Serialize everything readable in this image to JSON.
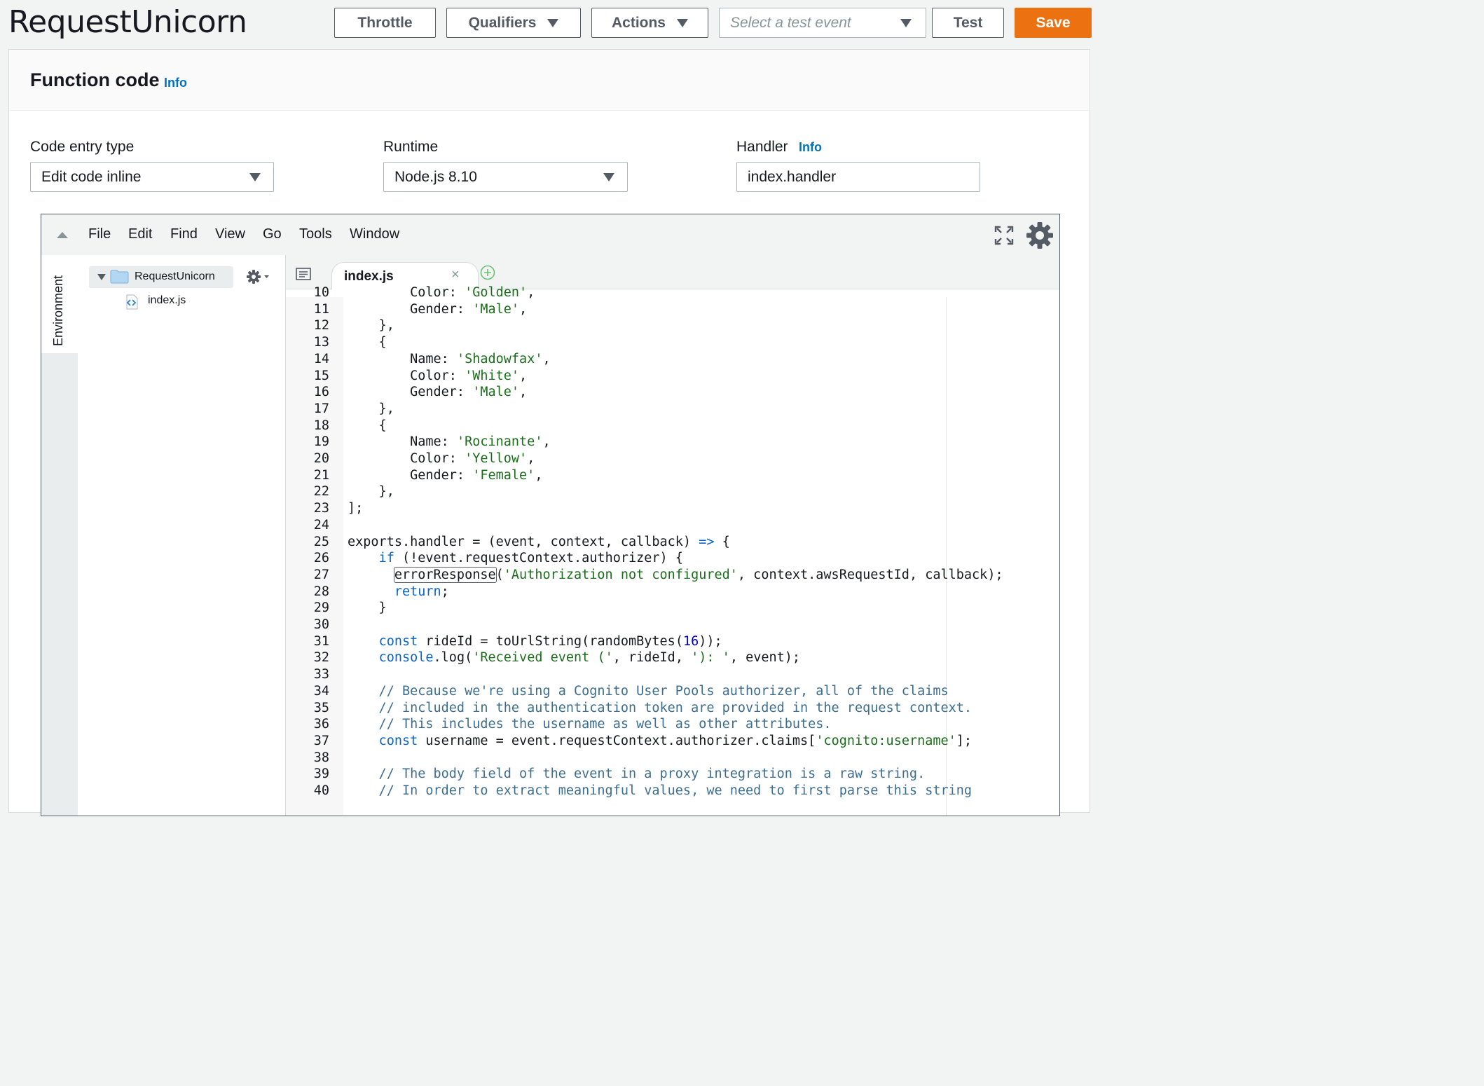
{
  "header": {
    "title": "RequestUnicorn",
    "throttle_label": "Throttle",
    "qualifiers_label": "Qualifiers",
    "actions_label": "Actions",
    "test_event_placeholder": "Select a test event",
    "test_label": "Test",
    "save_label": "Save"
  },
  "function_code": {
    "title": "Function code",
    "info_label": "Info",
    "code_entry_label": "Code entry type",
    "code_entry_value": "Edit code inline",
    "runtime_label": "Runtime",
    "runtime_value": "Node.js 8.10",
    "handler_label": "Handler",
    "handler_info": "Info",
    "handler_value": "index.handler"
  },
  "ide": {
    "menu": [
      "File",
      "Edit",
      "Find",
      "View",
      "Go",
      "Tools",
      "Window"
    ],
    "environment_label": "Environment",
    "tree_root": "RequestUnicorn",
    "tree_file": "index.js",
    "active_tab": "index.js",
    "close_glyph": "×",
    "colors": {
      "accent": "#ec7211",
      "link": "#0073bb",
      "string": "#1a6e1a",
      "keyword": "#0a64c8"
    }
  },
  "code_lines": [
    {
      "n": "10",
      "parts": [
        [
          "",
          "        Color: "
        ],
        [
          "str",
          "'Golden'"
        ],
        [
          "",
          ","
        ]
      ]
    },
    {
      "n": "11",
      "parts": [
        [
          "",
          "        Gender: "
        ],
        [
          "str",
          "'Male'"
        ],
        [
          "",
          ","
        ]
      ]
    },
    {
      "n": "12",
      "parts": [
        [
          "",
          "    },"
        ]
      ]
    },
    {
      "n": "13",
      "parts": [
        [
          "",
          "    {"
        ]
      ]
    },
    {
      "n": "14",
      "parts": [
        [
          "",
          "        Name: "
        ],
        [
          "str",
          "'Shadowfax'"
        ],
        [
          "",
          ","
        ]
      ]
    },
    {
      "n": "15",
      "parts": [
        [
          "",
          "        Color: "
        ],
        [
          "str",
          "'White'"
        ],
        [
          "",
          ","
        ]
      ]
    },
    {
      "n": "16",
      "parts": [
        [
          "",
          "        Gender: "
        ],
        [
          "str",
          "'Male'"
        ],
        [
          "",
          ","
        ]
      ]
    },
    {
      "n": "17",
      "parts": [
        [
          "",
          "    },"
        ]
      ]
    },
    {
      "n": "18",
      "parts": [
        [
          "",
          "    {"
        ]
      ]
    },
    {
      "n": "19",
      "parts": [
        [
          "",
          "        Name: "
        ],
        [
          "str",
          "'Rocinante'"
        ],
        [
          "",
          ","
        ]
      ]
    },
    {
      "n": "20",
      "parts": [
        [
          "",
          "        Color: "
        ],
        [
          "str",
          "'Yellow'"
        ],
        [
          "",
          ","
        ]
      ]
    },
    {
      "n": "21",
      "parts": [
        [
          "",
          "        Gender: "
        ],
        [
          "str",
          "'Female'"
        ],
        [
          "",
          ","
        ]
      ]
    },
    {
      "n": "22",
      "parts": [
        [
          "",
          "    },"
        ]
      ]
    },
    {
      "n": "23",
      "parts": [
        [
          "",
          "];"
        ]
      ]
    },
    {
      "n": "24",
      "parts": [
        [
          "",
          ""
        ]
      ]
    },
    {
      "n": "25",
      "parts": [
        [
          "",
          "exports.handler = (event, context, callback) "
        ],
        [
          "kw",
          "=>"
        ],
        [
          "",
          " {"
        ]
      ]
    },
    {
      "n": "26",
      "parts": [
        [
          "",
          "    "
        ],
        [
          "kw",
          "if"
        ],
        [
          "",
          " (!event.requestContext.authorizer) {"
        ]
      ]
    },
    {
      "n": "27",
      "parts": [
        [
          "",
          "      "
        ],
        [
          "hl",
          "errorResponse"
        ],
        [
          "",
          "("
        ],
        [
          "str",
          "'Authorization not configured'"
        ],
        [
          "",
          ", context.awsRequestId, callback);"
        ]
      ]
    },
    {
      "n": "28",
      "parts": [
        [
          "",
          "      "
        ],
        [
          "kw",
          "return"
        ],
        [
          "",
          ";"
        ]
      ]
    },
    {
      "n": "29",
      "parts": [
        [
          "",
          "    }"
        ]
      ]
    },
    {
      "n": "30",
      "parts": [
        [
          "",
          ""
        ]
      ]
    },
    {
      "n": "31",
      "parts": [
        [
          "",
          "    "
        ],
        [
          "kw",
          "const"
        ],
        [
          "",
          " rideId = toUrlString(randomBytes("
        ],
        [
          "num",
          "16"
        ],
        [
          "",
          "));"
        ]
      ]
    },
    {
      "n": "32",
      "parts": [
        [
          "",
          "    "
        ],
        [
          "kw",
          "console"
        ],
        [
          "",
          ".log("
        ],
        [
          "str",
          "'Received event ('"
        ],
        [
          "",
          ", rideId, "
        ],
        [
          "str",
          "'): '"
        ],
        [
          "",
          ", event);"
        ]
      ]
    },
    {
      "n": "33",
      "parts": [
        [
          "",
          ""
        ]
      ]
    },
    {
      "n": "34",
      "parts": [
        [
          "cmt",
          "    // Because we're using a Cognito User Pools authorizer, all of the claims"
        ]
      ]
    },
    {
      "n": "35",
      "parts": [
        [
          "cmt",
          "    // included in the authentication token are provided in the request context."
        ]
      ]
    },
    {
      "n": "36",
      "parts": [
        [
          "cmt",
          "    // This includes the username as well as other attributes."
        ]
      ]
    },
    {
      "n": "37",
      "parts": [
        [
          "",
          "    "
        ],
        [
          "kw",
          "const"
        ],
        [
          "",
          " username = event.requestContext.authorizer.claims["
        ],
        [
          "str",
          "'cognito:username'"
        ],
        [
          "",
          "];"
        ]
      ]
    },
    {
      "n": "38",
      "parts": [
        [
          "",
          ""
        ]
      ]
    },
    {
      "n": "39",
      "parts": [
        [
          "cmt",
          "    // The body field of the event in a proxy integration is a raw string."
        ]
      ]
    },
    {
      "n": "40",
      "parts": [
        [
          "cmt",
          "    // In order to extract meaningful values, we need to first parse this string"
        ]
      ]
    }
  ]
}
